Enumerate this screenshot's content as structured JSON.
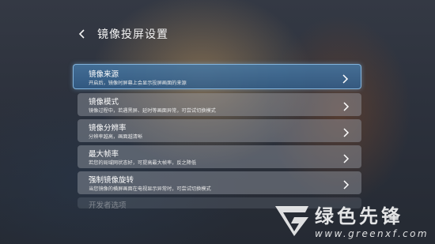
{
  "header": {
    "back_icon": "chevron-left-icon",
    "title": "镜像投屏设置"
  },
  "settings": {
    "items": [
      {
        "title": "镜像来源",
        "desc": "开启后，镜像时屏幕上会显示投屏画面的来源",
        "icon": "chevron-right-icon",
        "focused": true
      },
      {
        "title": "镜像模式",
        "desc": "镜像过程中，若遇黑屏、延时等画面异常，可尝试切换模式",
        "icon": "chevron-right-icon"
      },
      {
        "title": "镜像分辨率",
        "desc": "分辨率越高，画面越清晰",
        "icon": "chevron-right-icon"
      },
      {
        "title": "最大帧率",
        "desc": "若您的局域网状态好，可提高最大帧率，反之降低",
        "icon": "chevron-right-icon"
      },
      {
        "title": "强制镜像旋转",
        "desc": "当您镜像的横屏画面在电视显示异常时，可尝试切换模式",
        "icon": "chevron-right-icon"
      },
      {
        "title": "开发者选项"
      }
    ]
  },
  "watermark": {
    "name": "绿色先锋",
    "url": "www.greenxf.com"
  },
  "colors": {
    "focus_bg": "#3f6e9c",
    "focus_border": "#96c8f0",
    "item_bg": "#8c9099"
  }
}
